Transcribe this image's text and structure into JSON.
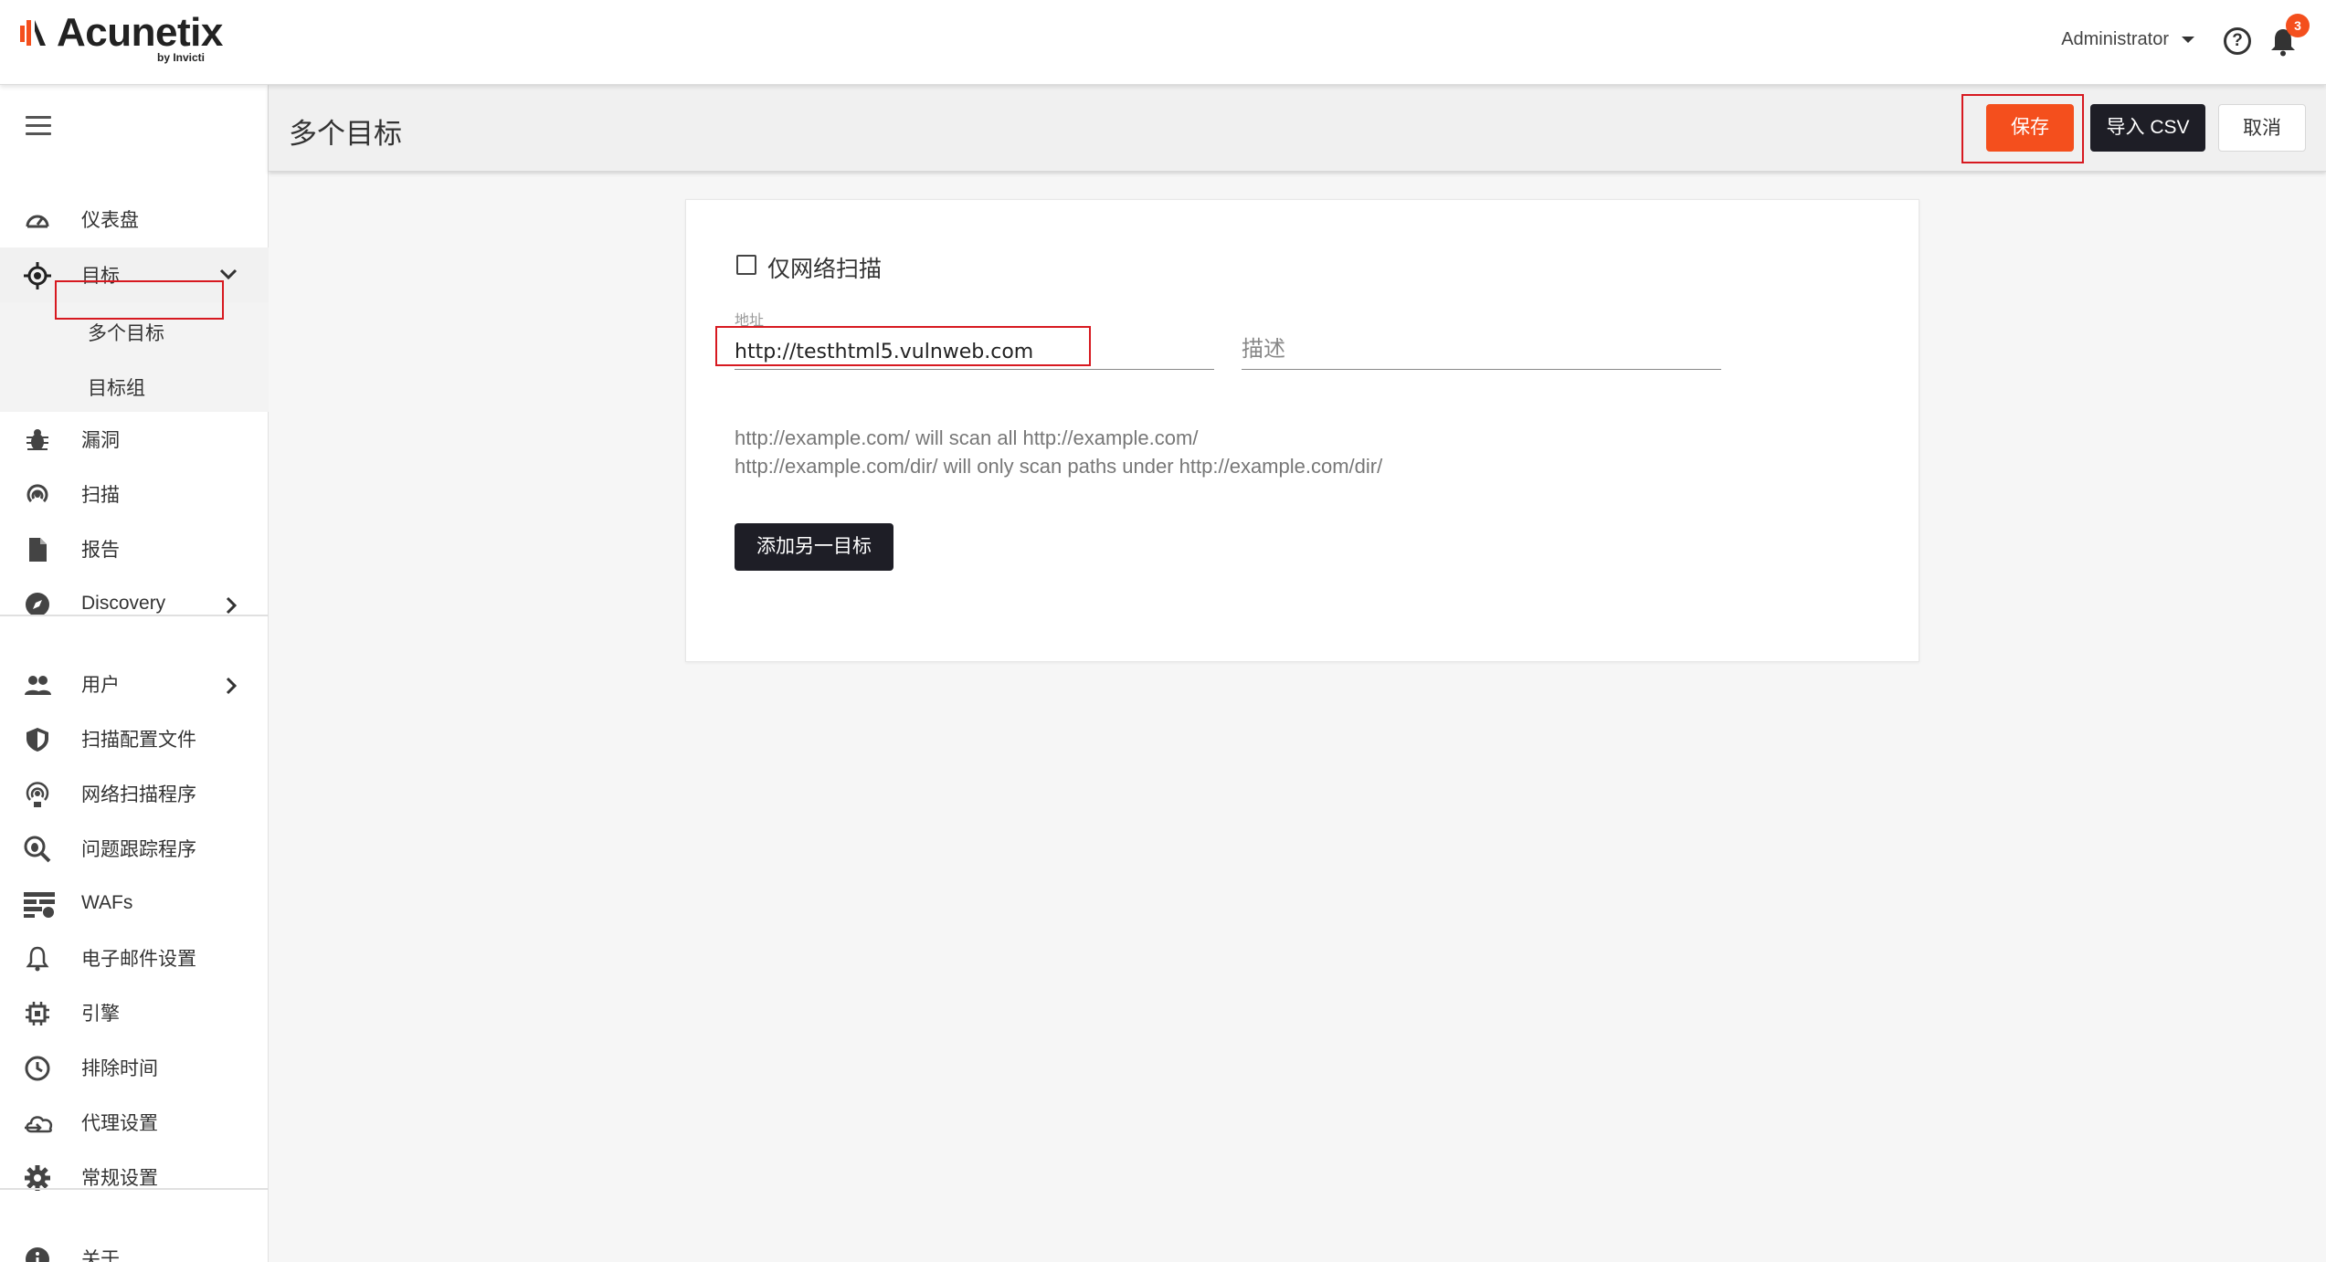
{
  "header": {
    "logo_text": "Acunetix",
    "logo_sub": "by Invicti",
    "user_name": "Administrator",
    "notification_count": "3",
    "help_glyph": "?"
  },
  "sidebar": {
    "items": [
      {
        "label": "仪表盘",
        "icon": "dashboard-icon"
      },
      {
        "label": "目标",
        "icon": "target-icon"
      },
      {
        "label": "多个目标"
      },
      {
        "label": "目标组"
      },
      {
        "label": "漏洞",
        "icon": "bug-icon"
      },
      {
        "label": "扫描",
        "icon": "scan-icon"
      },
      {
        "label": "报告",
        "icon": "report-icon"
      },
      {
        "label": "Discovery",
        "icon": "compass-icon"
      },
      {
        "label": "用户",
        "icon": "users-icon"
      },
      {
        "label": "扫描配置文件",
        "icon": "shield-icon"
      },
      {
        "label": "网络扫描程序",
        "icon": "network-scanner-icon"
      },
      {
        "label": "问题跟踪程序",
        "icon": "issue-tracker-icon"
      },
      {
        "label": "WAFs",
        "icon": "waf-icon"
      },
      {
        "label": "电子邮件设置",
        "icon": "bell-icon"
      },
      {
        "label": "引擎",
        "icon": "chip-icon"
      },
      {
        "label": "排除时间",
        "icon": "clock-icon"
      },
      {
        "label": "代理设置",
        "icon": "cloud-icon"
      },
      {
        "label": "常规设置",
        "icon": "gear-icon"
      },
      {
        "label": "关于",
        "icon": "info-icon"
      }
    ]
  },
  "page": {
    "title": "多个目标",
    "save_label": "保存",
    "import_csv_label": "导入 CSV",
    "cancel_label": "取消"
  },
  "form": {
    "network_only_label": "仅网络扫描",
    "address_caption": "地址",
    "address_value": "http://testhtml5.vulnweb.com",
    "description_placeholder": "描述",
    "help_line1": "http://example.com/ will scan all http://example.com/",
    "help_line2": "http://example.com/dir/ will only scan paths under http://example.com/dir/",
    "add_target_label": "添加另一目标"
  },
  "colors": {
    "accent": "#f44f1d",
    "dark_button": "#1e1e26",
    "highlight_box": "#d71920"
  }
}
